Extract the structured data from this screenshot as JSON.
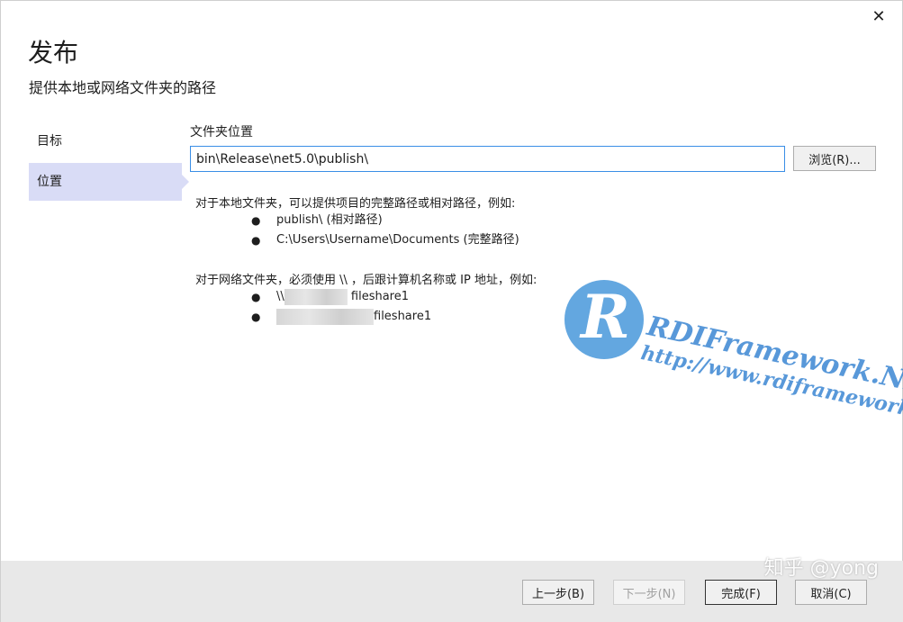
{
  "dialog": {
    "title": "发布",
    "subtitle": "提供本地或网络文件夹的路径",
    "close_glyph": "✕"
  },
  "nav": {
    "items": [
      {
        "label": "目标",
        "active": false
      },
      {
        "label": "位置",
        "active": true
      }
    ]
  },
  "location": {
    "field_label": "文件夹位置",
    "path_value": "bin\\Release\\net5.0\\publish\\",
    "browse_label": "浏览(R)..."
  },
  "help": {
    "local_intro": "对于本地文件夹，可以提供项目的完整路径或相对路径，例如:",
    "local_examples": [
      "publish\\ (相对路径)",
      "C:\\Users\\Username\\Documents (完整路径)"
    ],
    "network_intro": "对于网络文件夹，必须使用 \\\\ ，后跟计算机名称或 IP 地址，例如:",
    "network_examples": [
      {
        "prefix": "\\\\",
        "suffix": "fileshare1"
      },
      {
        "prefix": "",
        "suffix": "fileshare1"
      }
    ],
    "bullet": "●"
  },
  "watermark": {
    "logo_letter": "R",
    "brand": "RDIFramework.NET",
    "url": "http://www.rdiframework.net"
  },
  "footer": {
    "prev_label": "上一步(B)",
    "next_label": "下一步(N)",
    "finish_label": "完成(F)",
    "cancel_label": "取消(C)"
  },
  "overlay_watermark": "知乎 @yong"
}
